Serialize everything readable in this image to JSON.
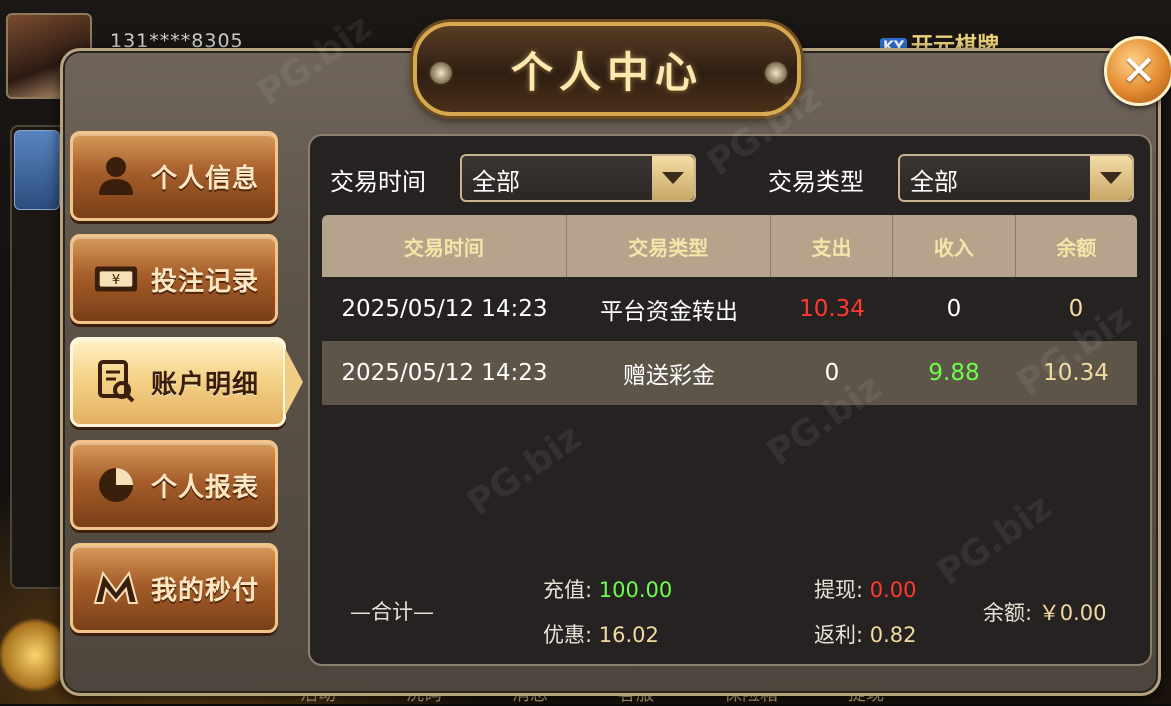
{
  "background": {
    "phone_masked": "131****8305",
    "brand_name": "开元棋牌",
    "brand_badge": "KY",
    "bottom_nav": [
      "活动",
      "洗码",
      "消息",
      "客服",
      "保险箱",
      "提现"
    ]
  },
  "modal": {
    "title": "个人中心",
    "close_symbol": "✕"
  },
  "menu": [
    {
      "label": "个人信息",
      "icon": "user-icon",
      "active": false
    },
    {
      "label": "投注记录",
      "icon": "banknote-icon",
      "active": false
    },
    {
      "label": "账户明细",
      "icon": "document-search-icon",
      "active": true
    },
    {
      "label": "个人报表",
      "icon": "pie-chart-icon",
      "active": false
    },
    {
      "label": "我的秒付",
      "icon": "m-logo-icon",
      "active": false
    }
  ],
  "filters": {
    "time_label": "交易时间",
    "time_value": "全部",
    "type_label": "交易类型",
    "type_value": "全部"
  },
  "table": {
    "headers": [
      "交易时间",
      "交易类型",
      "支出",
      "收入",
      "余额"
    ],
    "rows": [
      {
        "time": "2025/05/12 14:23",
        "type": "平台资金转出",
        "expense": "10.34",
        "income": "0",
        "balance": "0"
      },
      {
        "time": "2025/05/12 14:23",
        "type": "赠送彩金",
        "expense": "0",
        "income": "9.88",
        "balance": "10.34"
      }
    ]
  },
  "summary": {
    "title": "—合计—",
    "recharge_label": "充值: ",
    "recharge_value": "100.00",
    "withdraw_label": "提现: ",
    "withdraw_value": "0.00",
    "discount_label": "优惠: ",
    "discount_value": "16.02",
    "rebate_label": "返利: ",
    "rebate_value": "0.82",
    "balance_label": "余额: ",
    "balance_value": "￥0.00"
  },
  "watermark_text": "PG.biz",
  "colors": {
    "accent_gold": "#d6a850",
    "expense_red": "#ff3b30",
    "income_green": "#6bff4a"
  }
}
